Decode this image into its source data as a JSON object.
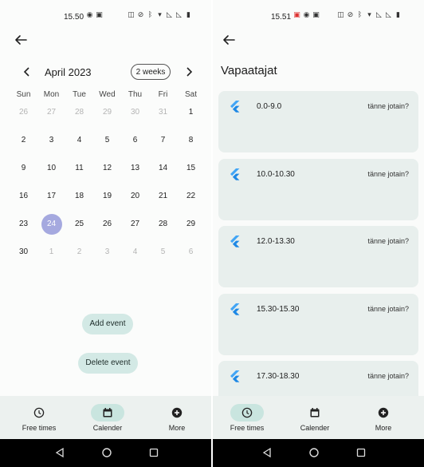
{
  "left": {
    "status": {
      "time": "15.50"
    },
    "calendar": {
      "month_label": "April 2023",
      "format_button": "2 weeks",
      "weekdays": [
        "Sun",
        "Mon",
        "Tue",
        "Wed",
        "Thu",
        "Fri",
        "Sat"
      ],
      "days": [
        {
          "d": "26",
          "out": true
        },
        {
          "d": "27",
          "out": true
        },
        {
          "d": "28",
          "out": true
        },
        {
          "d": "29",
          "out": true
        },
        {
          "d": "30",
          "out": true
        },
        {
          "d": "31",
          "out": true
        },
        {
          "d": "1",
          "out": false
        },
        {
          "d": "2",
          "out": false
        },
        {
          "d": "3",
          "out": false
        },
        {
          "d": "4",
          "out": false
        },
        {
          "d": "5",
          "out": false
        },
        {
          "d": "6",
          "out": false
        },
        {
          "d": "7",
          "out": false
        },
        {
          "d": "8",
          "out": false
        },
        {
          "d": "9",
          "out": false
        },
        {
          "d": "10",
          "out": false
        },
        {
          "d": "11",
          "out": false
        },
        {
          "d": "12",
          "out": false
        },
        {
          "d": "13",
          "out": false
        },
        {
          "d": "14",
          "out": false
        },
        {
          "d": "15",
          "out": false
        },
        {
          "d": "16",
          "out": false
        },
        {
          "d": "17",
          "out": false
        },
        {
          "d": "18",
          "out": false
        },
        {
          "d": "19",
          "out": false
        },
        {
          "d": "20",
          "out": false
        },
        {
          "d": "21",
          "out": false
        },
        {
          "d": "22",
          "out": false
        },
        {
          "d": "23",
          "out": false
        },
        {
          "d": "24",
          "out": false,
          "selected": true
        },
        {
          "d": "25",
          "out": false
        },
        {
          "d": "26",
          "out": false
        },
        {
          "d": "27",
          "out": false
        },
        {
          "d": "28",
          "out": false
        },
        {
          "d": "29",
          "out": false
        },
        {
          "d": "30",
          "out": false
        },
        {
          "d": "1",
          "out": true
        },
        {
          "d": "2",
          "out": true
        },
        {
          "d": "3",
          "out": true
        },
        {
          "d": "4",
          "out": true
        },
        {
          "d": "5",
          "out": true
        },
        {
          "d": "6",
          "out": true
        }
      ]
    },
    "buttons": {
      "add_event": "Add event",
      "delete_event": "Delete event"
    },
    "nav": {
      "active": "calender"
    }
  },
  "right": {
    "status": {
      "time": "15.51"
    },
    "title": "Vapaatajat",
    "slots": [
      {
        "time": "0.0-9.0",
        "note": "tänne jotain?"
      },
      {
        "time": "10.0-10.30",
        "note": "tänne jotain?"
      },
      {
        "time": "12.0-13.30",
        "note": "tänne jotain?"
      },
      {
        "time": "15.30-15.30",
        "note": "tänne jotain?"
      },
      {
        "time": "17.30-18.30",
        "note": "tänne jotain?"
      }
    ],
    "nav": {
      "active": "free-times"
    }
  },
  "nav_labels": {
    "free_times": "Free times",
    "calender": "Calender",
    "more": "More"
  },
  "colors": {
    "selected_day": "#a5a9df",
    "nav_active": "#c9e5df",
    "card_bg": "#e8efed",
    "button_bg": "#d3e9e5",
    "flutter_logo": "#42a5f5"
  }
}
